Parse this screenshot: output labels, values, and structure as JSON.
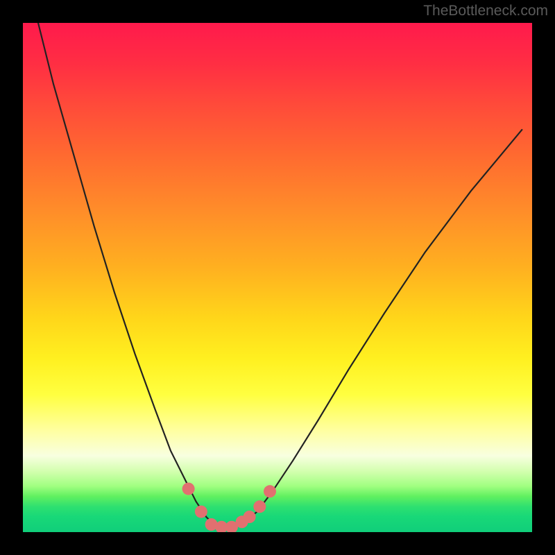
{
  "watermark": "TheBottleneck.com",
  "colors": {
    "black": "#000000",
    "curve": "#222222",
    "markerFill": "#e17070",
    "markerStroke": "#cc5555"
  },
  "chart_data": {
    "type": "line",
    "title": "",
    "xlabel": "",
    "ylabel": "",
    "xlim": [
      0,
      100
    ],
    "ylim": [
      0,
      100
    ],
    "series": [
      {
        "name": "bottleneck-curve",
        "x": [
          3,
          6,
          10,
          14,
          18,
          22,
          26,
          29,
          32,
          34,
          36,
          37.5,
          39,
          41,
          43.5,
          46,
          49,
          53,
          58,
          64,
          71,
          79,
          88,
          98
        ],
        "values": [
          100,
          88,
          74,
          60,
          47,
          35,
          24,
          16,
          10,
          6,
          3,
          1.5,
          1,
          1,
          2,
          4,
          8,
          14,
          22,
          32,
          43,
          55,
          67,
          79
        ]
      }
    ],
    "markers": {
      "name": "highlighted-points",
      "x": [
        32.5,
        35,
        37,
        39,
        41,
        43,
        44.5,
        46.5,
        48.5
      ],
      "values": [
        8.5,
        4,
        1.5,
        1,
        1,
        2,
        3,
        5,
        8
      ]
    }
  }
}
